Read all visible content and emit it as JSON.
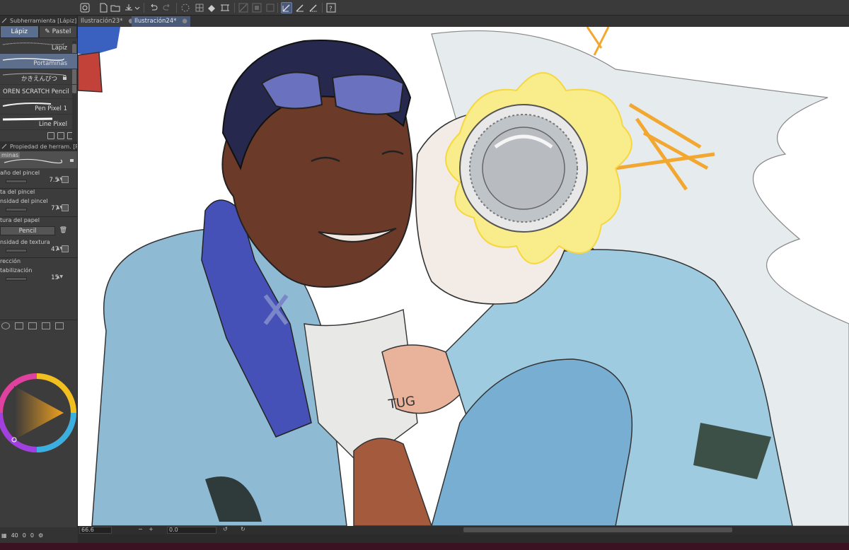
{
  "toolbar": {
    "icons": [
      "app-icon",
      "new-file-icon",
      "open-file-icon",
      "save-icon",
      "dropdown-icon",
      "undo-icon",
      "redo-icon",
      "loading-icon",
      "fill-icon",
      "transform-icon",
      "grid-icon",
      "ruler-icon",
      "mask-icon",
      "pen-pressure-icon",
      "pen-stabilize-icon",
      "pen-correct-icon",
      "help-icon"
    ]
  },
  "subtool_panel": {
    "title": "Subherramienta [Lápiz]",
    "tabs": [
      {
        "label": "Lápiz",
        "selected": true
      },
      {
        "label": "Pastel",
        "selected": false
      }
    ],
    "brushes": [
      {
        "label": "Lápiz",
        "selected": false
      },
      {
        "label": "Portaminas",
        "selected": true
      },
      {
        "label": "かきえんぴつ",
        "selected": false,
        "locked": true
      },
      {
        "label": "OREN SCRATCH Pencil",
        "selected": false
      },
      {
        "label": "Pen Pixel 1",
        "selected": false
      },
      {
        "label": "Line Pixel",
        "selected": false
      }
    ]
  },
  "tool_property": {
    "title": "Propiedad de herram. [Portaminas]",
    "preview_label": "minas",
    "brush_size_label": "año del pincel",
    "brush_size_value": "7.5",
    "brush_density_section": "ta del pincel",
    "density_label": "nsidad del pincel",
    "density_value": "77",
    "paper_texture_section": "tura del papel",
    "paper_value": "Pencil",
    "texture_density_label": "nsidad de textura",
    "texture_density_value": "47",
    "correction_section": "rección",
    "stabilization_label": "tabilización",
    "stabilization_value": "15"
  },
  "bottom_left": {
    "zoom_a": "40",
    "val_b": "0",
    "val_c": "0"
  },
  "document_tabs": [
    {
      "label": "Ilustración23*",
      "selected": false
    },
    {
      "label": "Ilustración24*",
      "selected": true
    }
  ],
  "status_bar": {
    "zoom": "66.6",
    "rotation": "0.0"
  },
  "canvas": {
    "lettering": "TUG"
  },
  "colors": {
    "accent": "#5a6e8f",
    "panel_bg": "#3c3c3c",
    "toolbar_bg": "#3a3a3a"
  }
}
